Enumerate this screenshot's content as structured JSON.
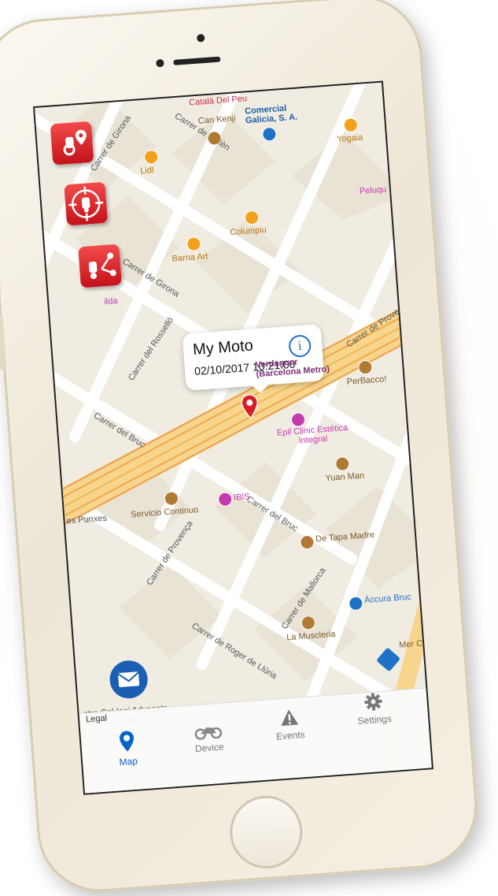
{
  "brand_colors": {
    "accent_red": "#d91e26",
    "tab_active": "#0a63c9",
    "mail_blue": "#1a5fb4"
  },
  "callout": {
    "title": "My Moto",
    "timestamp": "02/10/2017 10:21:00",
    "info_icon": "info-icon"
  },
  "fab_buttons": [
    {
      "icon": "moto-location-icon"
    },
    {
      "icon": "moto-target-icon"
    },
    {
      "icon": "moto-route-icon"
    }
  ],
  "map": {
    "streets": [
      "Carrer de Bailèn",
      "Carrer de Girona",
      "Carrer del Rosselló",
      "Carrer del Bruc",
      "Carrer de Provença",
      "Carrer del Bruc",
      "Carrer de Mallorca",
      "Carrer de Roger de Llúria",
      "Carrer de Provença",
      "Carrer de Provença"
    ],
    "pois": [
      "Català Del Peu",
      "Can Kenji",
      "Comercial Galicia, S. A.",
      "Lidl",
      "Yogaia",
      "Columpiu",
      "Barna Art",
      "Peluqu",
      "ilda",
      "Verdaguer (Barcelona Metro)",
      "PerBacco!",
      "Epil Clinic Estética Integral",
      "Yuan Man",
      "Servicio Continuo",
      "IBIS",
      "es Punxes",
      "De Tapa Madre",
      "Àccura Bruc",
      "La Muscleria",
      "Mer C",
      "stre Col·legi Advocats de Barcelona"
    ]
  },
  "tabbar": {
    "tabs": [
      {
        "label": "Map",
        "icon": "map-pin-icon",
        "active": true
      },
      {
        "label": "Device",
        "icon": "motorcycle-icon",
        "active": false
      },
      {
        "label": "Events",
        "icon": "warning-icon",
        "active": false
      },
      {
        "label": "Settings",
        "icon": "gear-icon",
        "active": false
      }
    ],
    "legal": "Legal"
  }
}
